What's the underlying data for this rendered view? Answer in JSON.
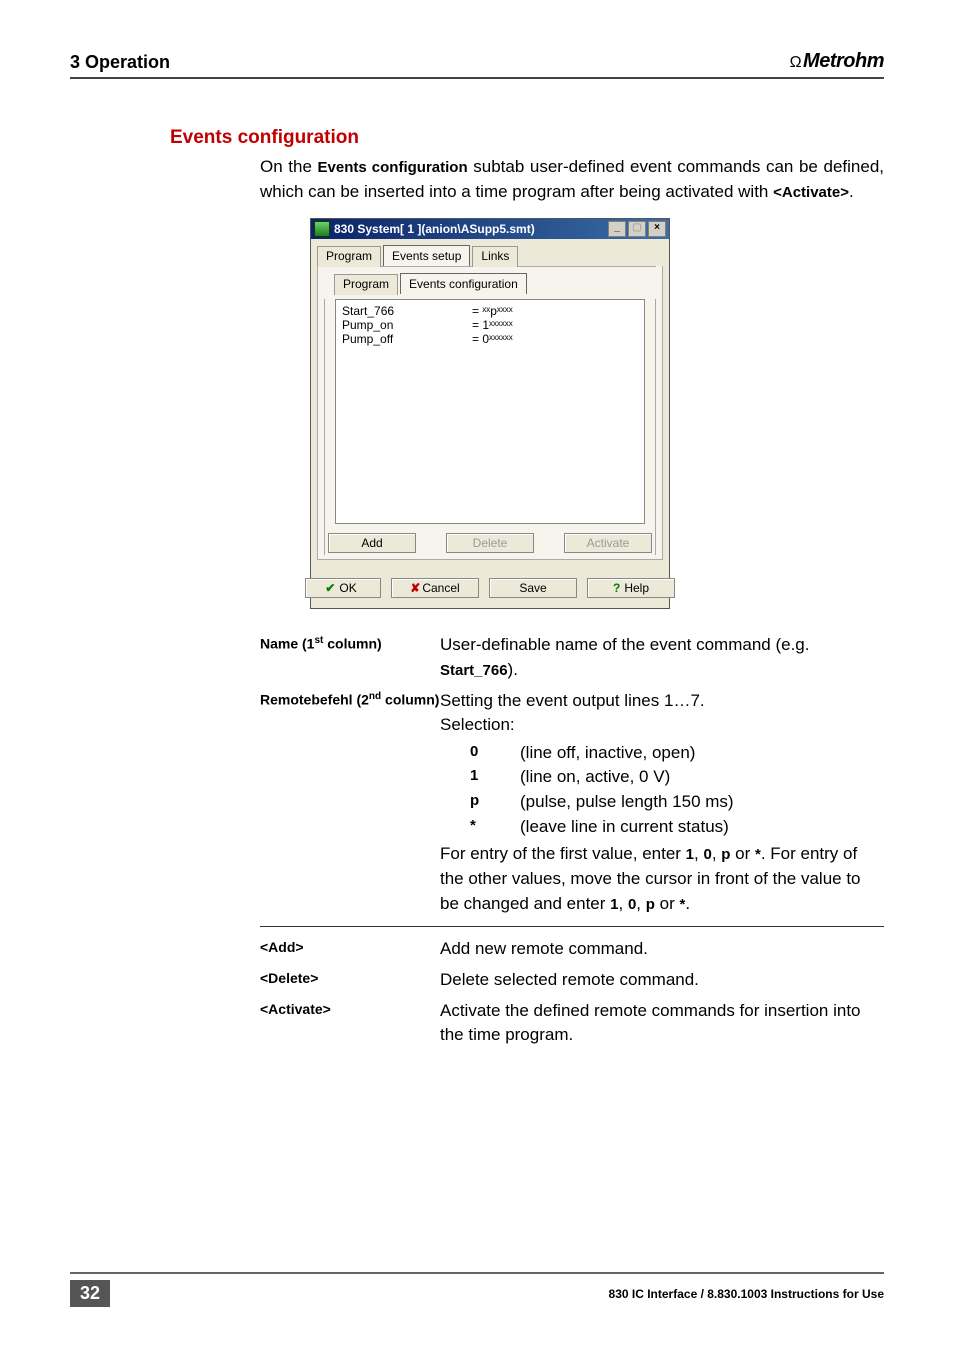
{
  "header": {
    "left": "3  Operation",
    "brand": "Metrohm",
    "brand_prefix": "Ω"
  },
  "section": {
    "heading": "Events configuration",
    "intro_segments": [
      "On the ",
      "Events configuration",
      " subtab user-defined event commands can be defined, which can be inserted into a time program after being activated with ",
      "<Activate>",
      "."
    ]
  },
  "dialog": {
    "title": "830 System[ 1 ](anion\\ASupp5.smt)",
    "tabs_top": [
      "Program",
      "Events setup",
      "Links"
    ],
    "tabs_top_active_index": 1,
    "tabs_sub": [
      "Program",
      "Events configuration"
    ],
    "tabs_sub_active_index": 1,
    "events": [
      {
        "name": "Start_766",
        "value": "= ˣˣpˣˣˣˣ"
      },
      {
        "name": "Pump_on",
        "value": "= 1ˣˣˣˣˣˣ"
      },
      {
        "name": "Pump_off",
        "value": "= 0ˣˣˣˣˣˣ"
      }
    ],
    "buttons_row1": {
      "add": "Add",
      "delete": "Delete",
      "activate": "Activate"
    },
    "buttons_row2": {
      "ok": "OK",
      "cancel": "Cancel",
      "save": "Save",
      "help": "Help"
    },
    "win_buttons": {
      "min": "_",
      "max": "▢",
      "close": "×"
    }
  },
  "desc": {
    "name_row": {
      "label": "Name (1",
      "label_sup": "st",
      "label_tail": " column)",
      "body_before": "User-definable name of the event command (e.g. ",
      "body_bold": "Start_766",
      "body_after": ")."
    },
    "remote_row": {
      "label": "Remotebefehl (2",
      "label_sup": "nd",
      "label_tail": " column)",
      "line1": "Setting the event output lines 1…7.",
      "line2": "Selection:",
      "options": [
        {
          "k": "0",
          "v": "(line off, inactive, open)"
        },
        {
          "k": "1",
          "v": "(line on, active, 0 V)"
        },
        {
          "k": "p",
          "v": "(pulse, pulse length 150 ms)"
        },
        {
          "k": "*",
          "v": "(leave line in current status)"
        }
      ],
      "tail_before": "For entry of the first value, enter ",
      "tail_bold1": "1",
      "tail_sep1": ", ",
      "tail_bold2": "0",
      "tail_sep2": ", ",
      "tail_bold3": "p",
      "tail_mid": " or ",
      "tail_bold4": "*",
      "tail_after1": ". For entry of the other values, move the cursor in front of the value to be changed and enter ",
      "tail_bold5": "1",
      "tail_sep3": ", ",
      "tail_bold6": "0",
      "tail_sep4": ", ",
      "tail_bold7": "p",
      "tail_mid2": " or ",
      "tail_bold8": "*",
      "tail_end": "."
    },
    "add_row": {
      "label": "<Add>",
      "body": "Add new remote command."
    },
    "delete_row": {
      "label": "<Delete>",
      "body": "Delete selected remote command."
    },
    "activate_row": {
      "label": "<Activate>",
      "body": "Activate the defined remote commands for insertion into the time program."
    }
  },
  "footer": {
    "page": "32",
    "text": "830 IC Interface / 8.830.1003 Instructions for Use"
  }
}
